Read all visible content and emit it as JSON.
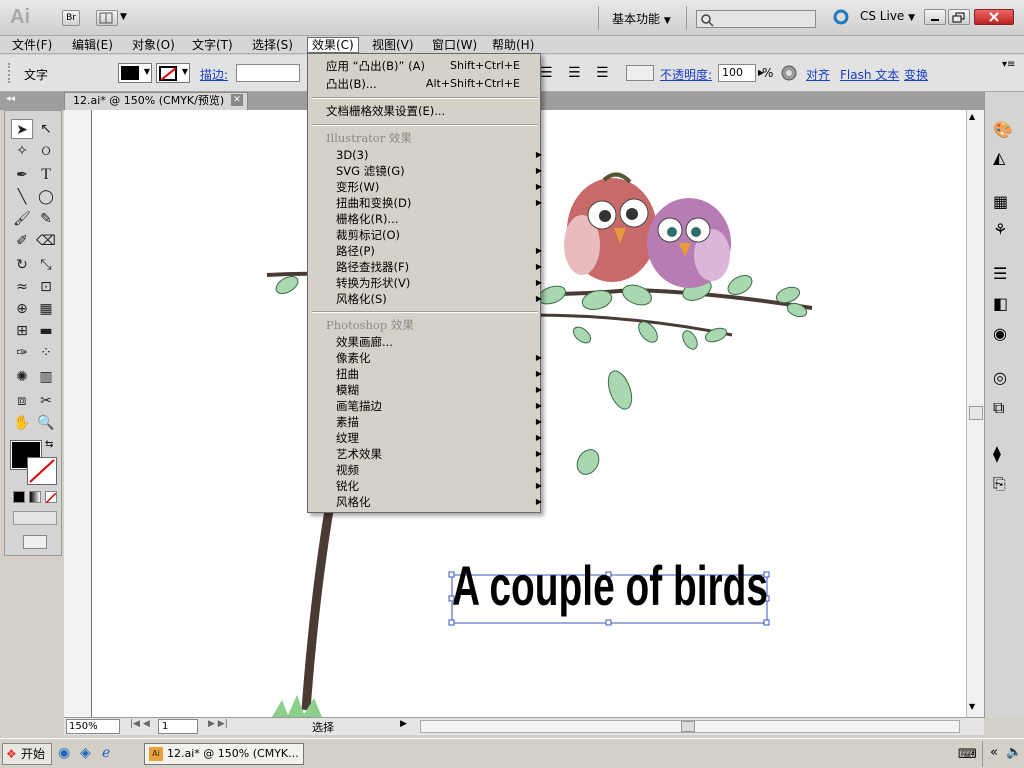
{
  "app": {
    "logo": "Ai",
    "bridge": "Br",
    "workspace": "基本功能",
    "cslive": "CS Live"
  },
  "menubar": [
    "文件(F)",
    "编辑(E)",
    "对象(O)",
    "文字(T)",
    "选择(S)",
    "效果(C)",
    "视图(V)",
    "窗口(W)",
    "帮助(H)"
  ],
  "control": {
    "label": "文字",
    "stroke": "描边:",
    "opacity_label": "不透明度:",
    "opacity_value": "100",
    "percent": "%",
    "align": "对齐",
    "flash_text": "Flash 文本",
    "transform": "变换"
  },
  "doc_tab": "12.ai* @ 150% (CMYK/预览)",
  "effects_menu": {
    "apply": "应用 “凸出(B)” (A)",
    "apply_sc": "Shift+Ctrl+E",
    "extrude": "凸出(B)...",
    "extrude_sc": "Alt+Shift+Ctrl+E",
    "doc_raster": "文档栅格效果设置(E)...",
    "ill_header": "Illustrator 效果",
    "ill_items": [
      "3D(3)",
      "SVG 滤镜(G)",
      "变形(W)",
      "扭曲和变换(D)",
      "栅格化(R)...",
      "裁剪标记(O)",
      "路径(P)",
      "路径查找器(F)",
      "转换为形状(V)",
      "风格化(S)"
    ],
    "ps_header": "Photoshop 效果",
    "ps_items": [
      "效果画廊...",
      "像素化",
      "扭曲",
      "模糊",
      "画笔描边",
      "素描",
      "纹理",
      "艺术效果",
      "视频",
      "锐化",
      "风格化"
    ]
  },
  "artwork": {
    "text": "A couple of birds"
  },
  "status": {
    "zoom": "150%",
    "page": "1",
    "mode": "选择"
  },
  "taskbar": {
    "start": "开始",
    "task": "12.ai* @ 150% (CMYK..."
  }
}
